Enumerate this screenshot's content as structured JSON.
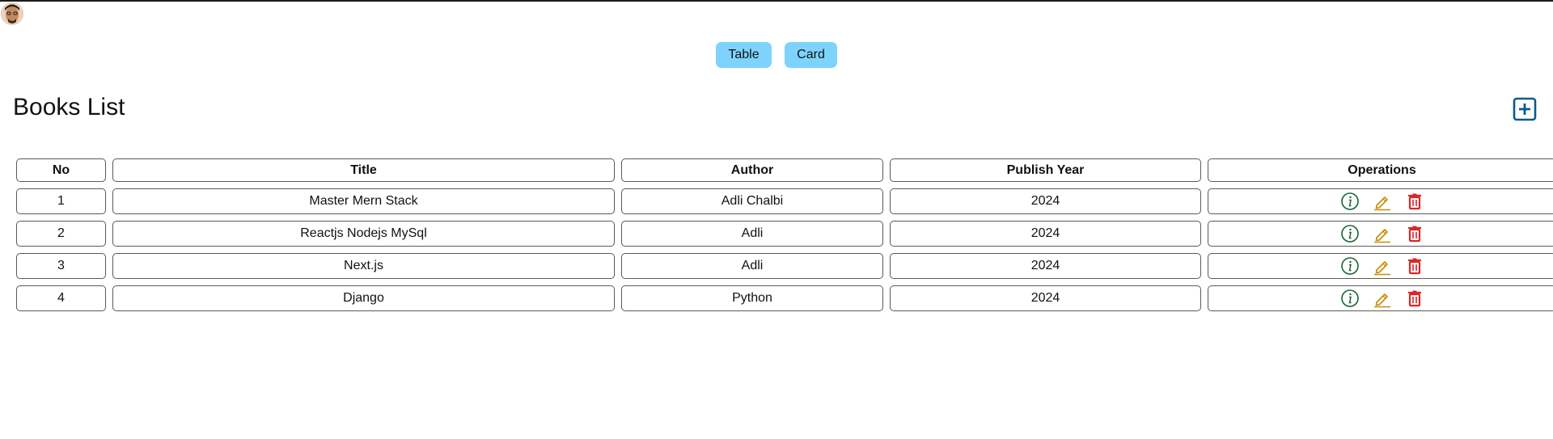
{
  "view_toggle": {
    "table_label": "Table",
    "card_label": "Card"
  },
  "page": {
    "title": "Books List"
  },
  "icons": {
    "avatar": "user-avatar",
    "add": "plus-square-icon",
    "info": "info-circle-icon",
    "edit": "pencil-icon",
    "delete": "trash-icon"
  },
  "colors": {
    "toggle_button_bg": "#7dd3fc",
    "add_icon": "#0b5a8a",
    "info_icon": "#166534",
    "edit_icon": "#ca8a04",
    "delete_icon": "#dc2626"
  },
  "table": {
    "headers": [
      "No",
      "Title",
      "Author",
      "Publish Year",
      "Operations"
    ],
    "rows": [
      {
        "no": "1",
        "title": "Master Mern Stack",
        "author": "Adli Chalbi",
        "year": "2024"
      },
      {
        "no": "2",
        "title": "Reactjs Nodejs MySql",
        "author": "Adli",
        "year": "2024"
      },
      {
        "no": "3",
        "title": "Next.js",
        "author": "Adli",
        "year": "2024"
      },
      {
        "no": "4",
        "title": "Django",
        "author": "Python",
        "year": "2024"
      }
    ]
  }
}
